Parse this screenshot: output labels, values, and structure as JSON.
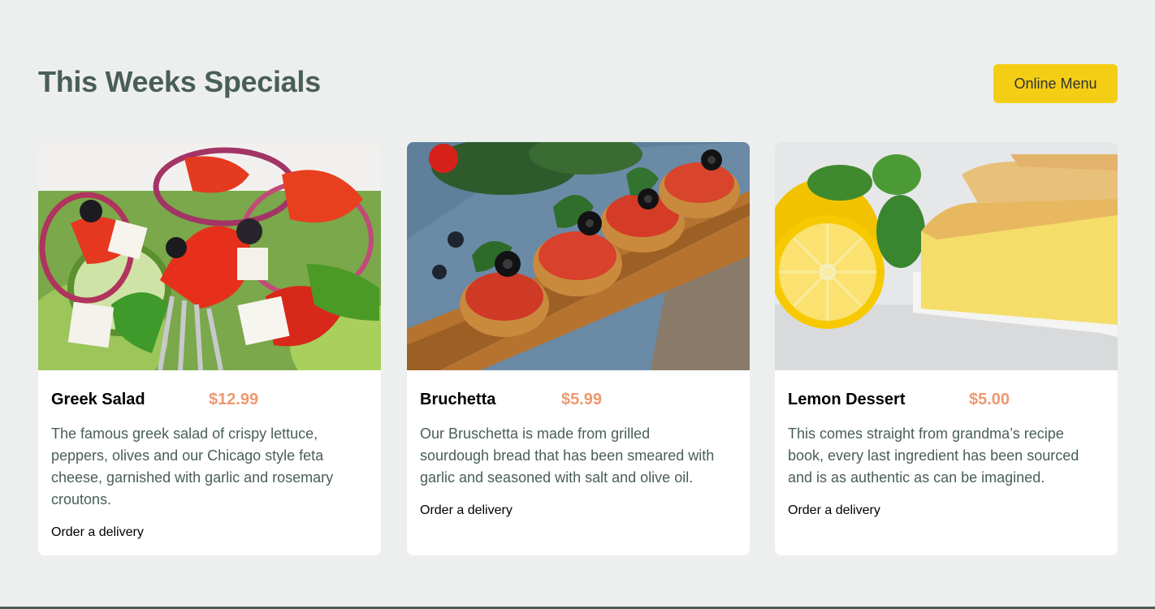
{
  "section": {
    "title": "This Weeks Specials",
    "menu_button_label": "Online Menu"
  },
  "colors": {
    "primary_green": "#495e57",
    "primary_yellow": "#f4ce14",
    "price_orange": "#ee9972",
    "background": "#edefee"
  },
  "cards": [
    {
      "name": "Greek Salad",
      "price": "$12.99",
      "description": "The famous greek salad of crispy lettuce, peppers, olives and our Chicago style feta cheese, garnished with garlic and rosemary croutons.",
      "order_label": "Order a delivery",
      "image_icon": "greek-salad-photo"
    },
    {
      "name": "Bruchetta",
      "price": "$5.99",
      "description": "Our Bruschetta is made from grilled sourdough bread that has been smeared with garlic and seasoned with salt and olive oil.",
      "order_label": "Order a delivery",
      "image_icon": "bruschetta-photo"
    },
    {
      "name": "Lemon Dessert",
      "price": "$5.00",
      "description": "This comes straight from grandma’s recipe book, every last ingredient has been sourced and is as authentic as can be imagined.",
      "order_label": "Order a delivery",
      "image_icon": "lemon-dessert-photo"
    }
  ]
}
